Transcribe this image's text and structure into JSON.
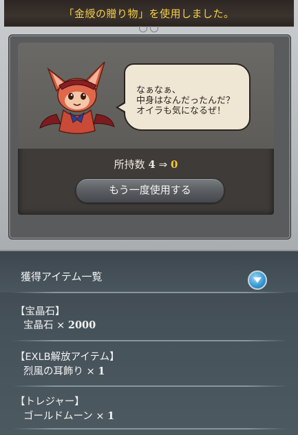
{
  "modal": {
    "title": "「金綬の贈り物」を使用しました。",
    "speech": "なぁなぁ、\n中身はなんだったんだ？\nオイラも気になるぜ！",
    "count_label": "所持数",
    "count_before": "4",
    "count_arrow": "⇒",
    "count_after": "0",
    "use_again_label": "もう一度使用する"
  },
  "list": {
    "title": "獲得アイテム一覧",
    "collapse_icon": "chevron-down-icon",
    "groups": [
      {
        "category": "【宝晶石】",
        "item": "宝晶石",
        "times": "×",
        "qty": "2000"
      },
      {
        "category": "【EXLB解放アイテム】",
        "item": "烈風の耳飾り",
        "times": "×",
        "qty": "1"
      },
      {
        "category": "【トレジャー】",
        "item": "ゴールドムーン",
        "times": "×",
        "qty": "1"
      }
    ]
  },
  "colors": {
    "title_text": "#f4d04a",
    "count_after": "#f2c73a",
    "list_bg": "#46525a"
  }
}
